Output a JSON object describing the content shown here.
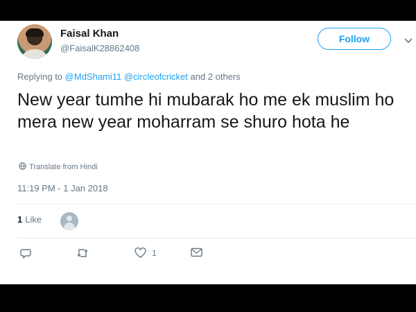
{
  "tweet": {
    "author": {
      "display_name": "Faisal Khan",
      "handle": "@FaisalK28862408"
    },
    "follow_label": "Follow",
    "reply": {
      "prefix": "Replying to",
      "mention_1": "@MdShami11",
      "mention_2": "@circleofcricket",
      "suffix": "and 2 others"
    },
    "text": "New year tumhe hi mubarak ho me ek muslim ho mera new year moharram se shuro hota he",
    "translate_label": "Translate from Hindi",
    "timestamp": "11:19 PM - 1 Jan 2018",
    "likes": {
      "count": "1",
      "label": "Like"
    },
    "actions": {
      "like_count": "1"
    }
  },
  "icons": {
    "menu": "chevron-down-icon",
    "translate": "globe-icon",
    "reply": "reply-icon",
    "retweet": "retweet-icon",
    "like": "heart-icon",
    "message": "envelope-icon"
  },
  "colors": {
    "accent": "#1da1f2",
    "secondary_text": "#657786",
    "primary_text": "#14171a",
    "frame": "#000000"
  }
}
